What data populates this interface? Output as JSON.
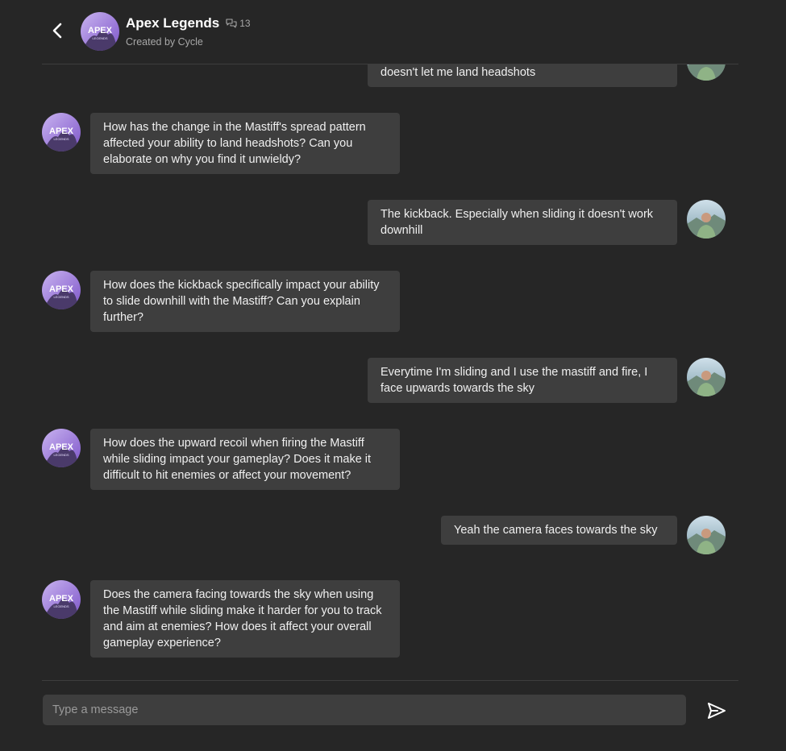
{
  "header": {
    "title": "Apex Legends",
    "count": "13",
    "subtitle": "Created by Cycle"
  },
  "messages": [
    {
      "from": "user",
      "text": "doesn't let me land headshots"
    },
    {
      "from": "bot",
      "text": "How has the change in the Mastiff's spread pattern affected your ability to land headshots? Can you elaborate on why you find it unwieldy?"
    },
    {
      "from": "user",
      "text": "The kickback. Especially when sliding it doesn't work downhill"
    },
    {
      "from": "bot",
      "text": "How does the kickback specifically impact your ability to slide downhill with the Mastiff? Can you explain further?"
    },
    {
      "from": "user",
      "text": "Everytime I'm sliding and I use the mastiff and fire, I face upwards towards the sky"
    },
    {
      "from": "bot",
      "text": "How does the upward recoil when firing the Mastiff while sliding impact your gameplay? Does it make it difficult to hit enemies or affect your movement?"
    },
    {
      "from": "user",
      "text": "Yeah the camera faces towards the sky"
    },
    {
      "from": "bot",
      "text": "Does the camera facing towards the sky when using the Mastiff while sliding make it harder for you to track and aim at enemies? How does it affect your overall gameplay experience?"
    }
  ],
  "composer": {
    "placeholder": "Type a message"
  },
  "icons": {
    "back": "chevron-left-icon",
    "count": "chat-bubbles-icon",
    "send": "send-icon"
  },
  "colors": {
    "background": "#262626",
    "bubble": "#3e3e3e",
    "text": "#f0f0f0",
    "muted": "#a8a8a8"
  }
}
